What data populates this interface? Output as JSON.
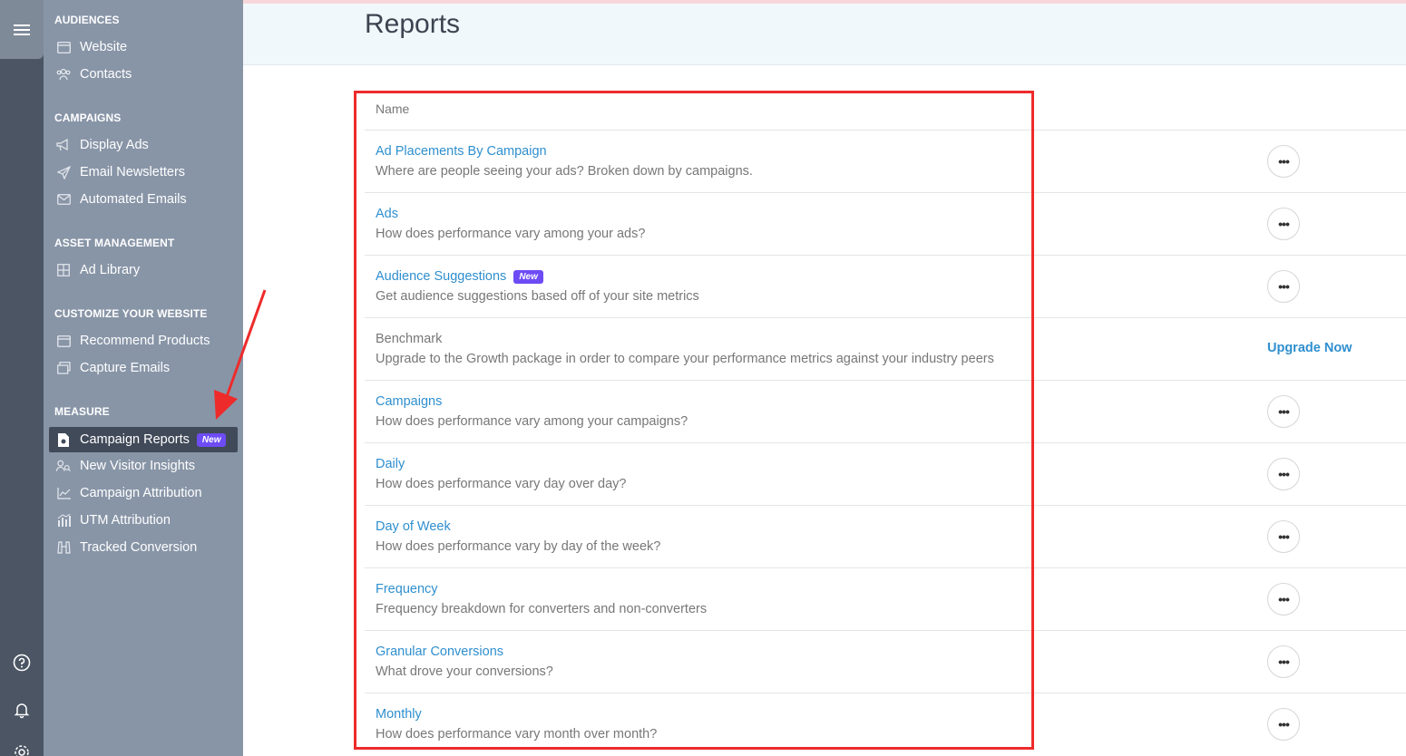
{
  "page": {
    "title": "Reports"
  },
  "sidebar": {
    "sections": [
      {
        "title": "AUDIENCES",
        "items": [
          {
            "label": "Website",
            "icon": "window-icon"
          },
          {
            "label": "Contacts",
            "icon": "users-icon"
          }
        ]
      },
      {
        "title": "CAMPAIGNS",
        "items": [
          {
            "label": "Display Ads",
            "icon": "megaphone-icon"
          },
          {
            "label": "Email Newsletters",
            "icon": "paper-plane-icon"
          },
          {
            "label": "Automated Emails",
            "icon": "envelope-icon"
          }
        ]
      },
      {
        "title": "ASSET MANAGEMENT",
        "items": [
          {
            "label": "Ad Library",
            "icon": "grid-icon"
          }
        ]
      },
      {
        "title": "CUSTOMIZE YOUR WEBSITE",
        "items": [
          {
            "label": "Recommend Products",
            "icon": "window-icon"
          },
          {
            "label": "Capture Emails",
            "icon": "layers-icon"
          }
        ]
      },
      {
        "title": "MEASURE",
        "items": [
          {
            "label": "Campaign Reports",
            "icon": "report-file-icon",
            "badge": "New",
            "active": true
          },
          {
            "label": "New Visitor Insights",
            "icon": "user-search-icon"
          },
          {
            "label": "Campaign Attribution",
            "icon": "line-chart-icon"
          },
          {
            "label": "UTM Attribution",
            "icon": "bar-chart-icon"
          },
          {
            "label": "Tracked Conversion",
            "icon": "binoculars-icon"
          }
        ]
      }
    ]
  },
  "rail": {
    "icons": [
      "menu-icon",
      "help-icon",
      "bell-icon",
      "settings-icon"
    ]
  },
  "table": {
    "column_name": "Name",
    "rows": [
      {
        "title": "Ad Placements By Campaign",
        "description": "Where are people seeing your ads? Broken down by campaigns.",
        "action": "more"
      },
      {
        "title": "Ads",
        "description": "How does performance vary among your ads?",
        "action": "more"
      },
      {
        "title": "Audience Suggestions",
        "badge": "New",
        "description": "Get audience suggestions based off of your site metrics",
        "action": "more"
      },
      {
        "title": "Benchmark",
        "description": "Upgrade to the Growth package in order to compare your performance metrics against your industry peers",
        "action": "upgrade",
        "action_label": "Upgrade Now",
        "locked": true
      },
      {
        "title": "Campaigns",
        "description": "How does performance vary among your campaigns?",
        "action": "more"
      },
      {
        "title": "Daily",
        "description": "How does performance vary day over day?",
        "action": "more"
      },
      {
        "title": "Day of Week",
        "description": "How does performance vary by day of the week?",
        "action": "more"
      },
      {
        "title": "Frequency",
        "description": "Frequency breakdown for converters and non-converters",
        "action": "more"
      },
      {
        "title": "Granular Conversions",
        "description": "What drove your conversions?",
        "action": "more"
      },
      {
        "title": "Monthly",
        "description": "How does performance vary month over month?",
        "action": "more"
      }
    ]
  },
  "colors": {
    "accent": "#2f8fcf",
    "badge": "#6d4cf5",
    "annotation": "#ee2b2b",
    "sidebar": "#8895a7",
    "rail": "#4b5563"
  }
}
